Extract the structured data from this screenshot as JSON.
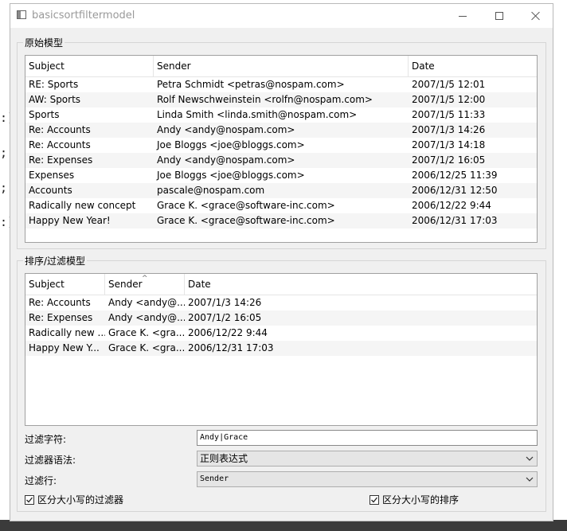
{
  "window": {
    "title": "basicsortfiltermodel"
  },
  "background": {
    "glyphs": [
      ":)",
      ";",
      ";",
      ":)"
    ]
  },
  "source_group": {
    "title": "原始模型",
    "columns": [
      "Subject",
      "Sender",
      "Date"
    ],
    "rows": [
      {
        "subject": "RE: Sports",
        "sender": "Petra Schmidt <petras@nospam.com>",
        "date": "2007/1/5 12:01"
      },
      {
        "subject": "AW: Sports",
        "sender": "Rolf Newschweinstein <rolfn@nospam.com>",
        "date": "2007/1/5 12:00"
      },
      {
        "subject": "Sports",
        "sender": "Linda Smith <linda.smith@nospam.com>",
        "date": "2007/1/5 11:33"
      },
      {
        "subject": "Re: Accounts",
        "sender": "Andy <andy@nospam.com>",
        "date": "2007/1/3 14:26"
      },
      {
        "subject": "Re: Accounts",
        "sender": "Joe Bloggs <joe@bloggs.com>",
        "date": "2007/1/3 14:18"
      },
      {
        "subject": "Re: Expenses",
        "sender": "Andy <andy@nospam.com>",
        "date": "2007/1/2 16:05"
      },
      {
        "subject": "Expenses",
        "sender": "Joe Bloggs <joe@bloggs.com>",
        "date": "2006/12/25 11:39"
      },
      {
        "subject": "Accounts",
        "sender": "pascale@nospam.com",
        "date": "2006/12/31 12:50"
      },
      {
        "subject": "Radically new concept",
        "sender": "Grace K. <grace@software-inc.com>",
        "date": "2006/12/22 9:44"
      },
      {
        "subject": "Happy New Year!",
        "sender": "Grace K. <grace@software-inc.com>",
        "date": "2006/12/31 17:03"
      }
    ]
  },
  "proxy_group": {
    "title": "排序/过滤模型",
    "columns": [
      "Subject",
      "Sender",
      "Date"
    ],
    "sort_indicator": "^",
    "rows": [
      {
        "subject": "Re: Accounts",
        "sender": "Andy <andy@...",
        "date": "2007/1/3 14:26"
      },
      {
        "subject": "Re: Expenses",
        "sender": "Andy <andy@...",
        "date": "2007/1/2 16:05"
      },
      {
        "subject": "Radically new ...",
        "sender": "Grace K. <gra...",
        "date": "2006/12/22 9:44"
      },
      {
        "subject": "Happy New Y...",
        "sender": "Grace K. <gra...",
        "date": "2006/12/31 17:03"
      }
    ]
  },
  "filter": {
    "pattern_label": "过滤字符:",
    "pattern_value": "Andy|Grace",
    "syntax_label": "过滤器语法:",
    "syntax_value": "正则表达式",
    "column_label": "过滤行:",
    "column_value": "Sender",
    "case_filter_label": "区分大小写的过滤器",
    "case_filter_checked": true,
    "case_sort_label": "区分大小写的排序",
    "case_sort_checked": true
  }
}
